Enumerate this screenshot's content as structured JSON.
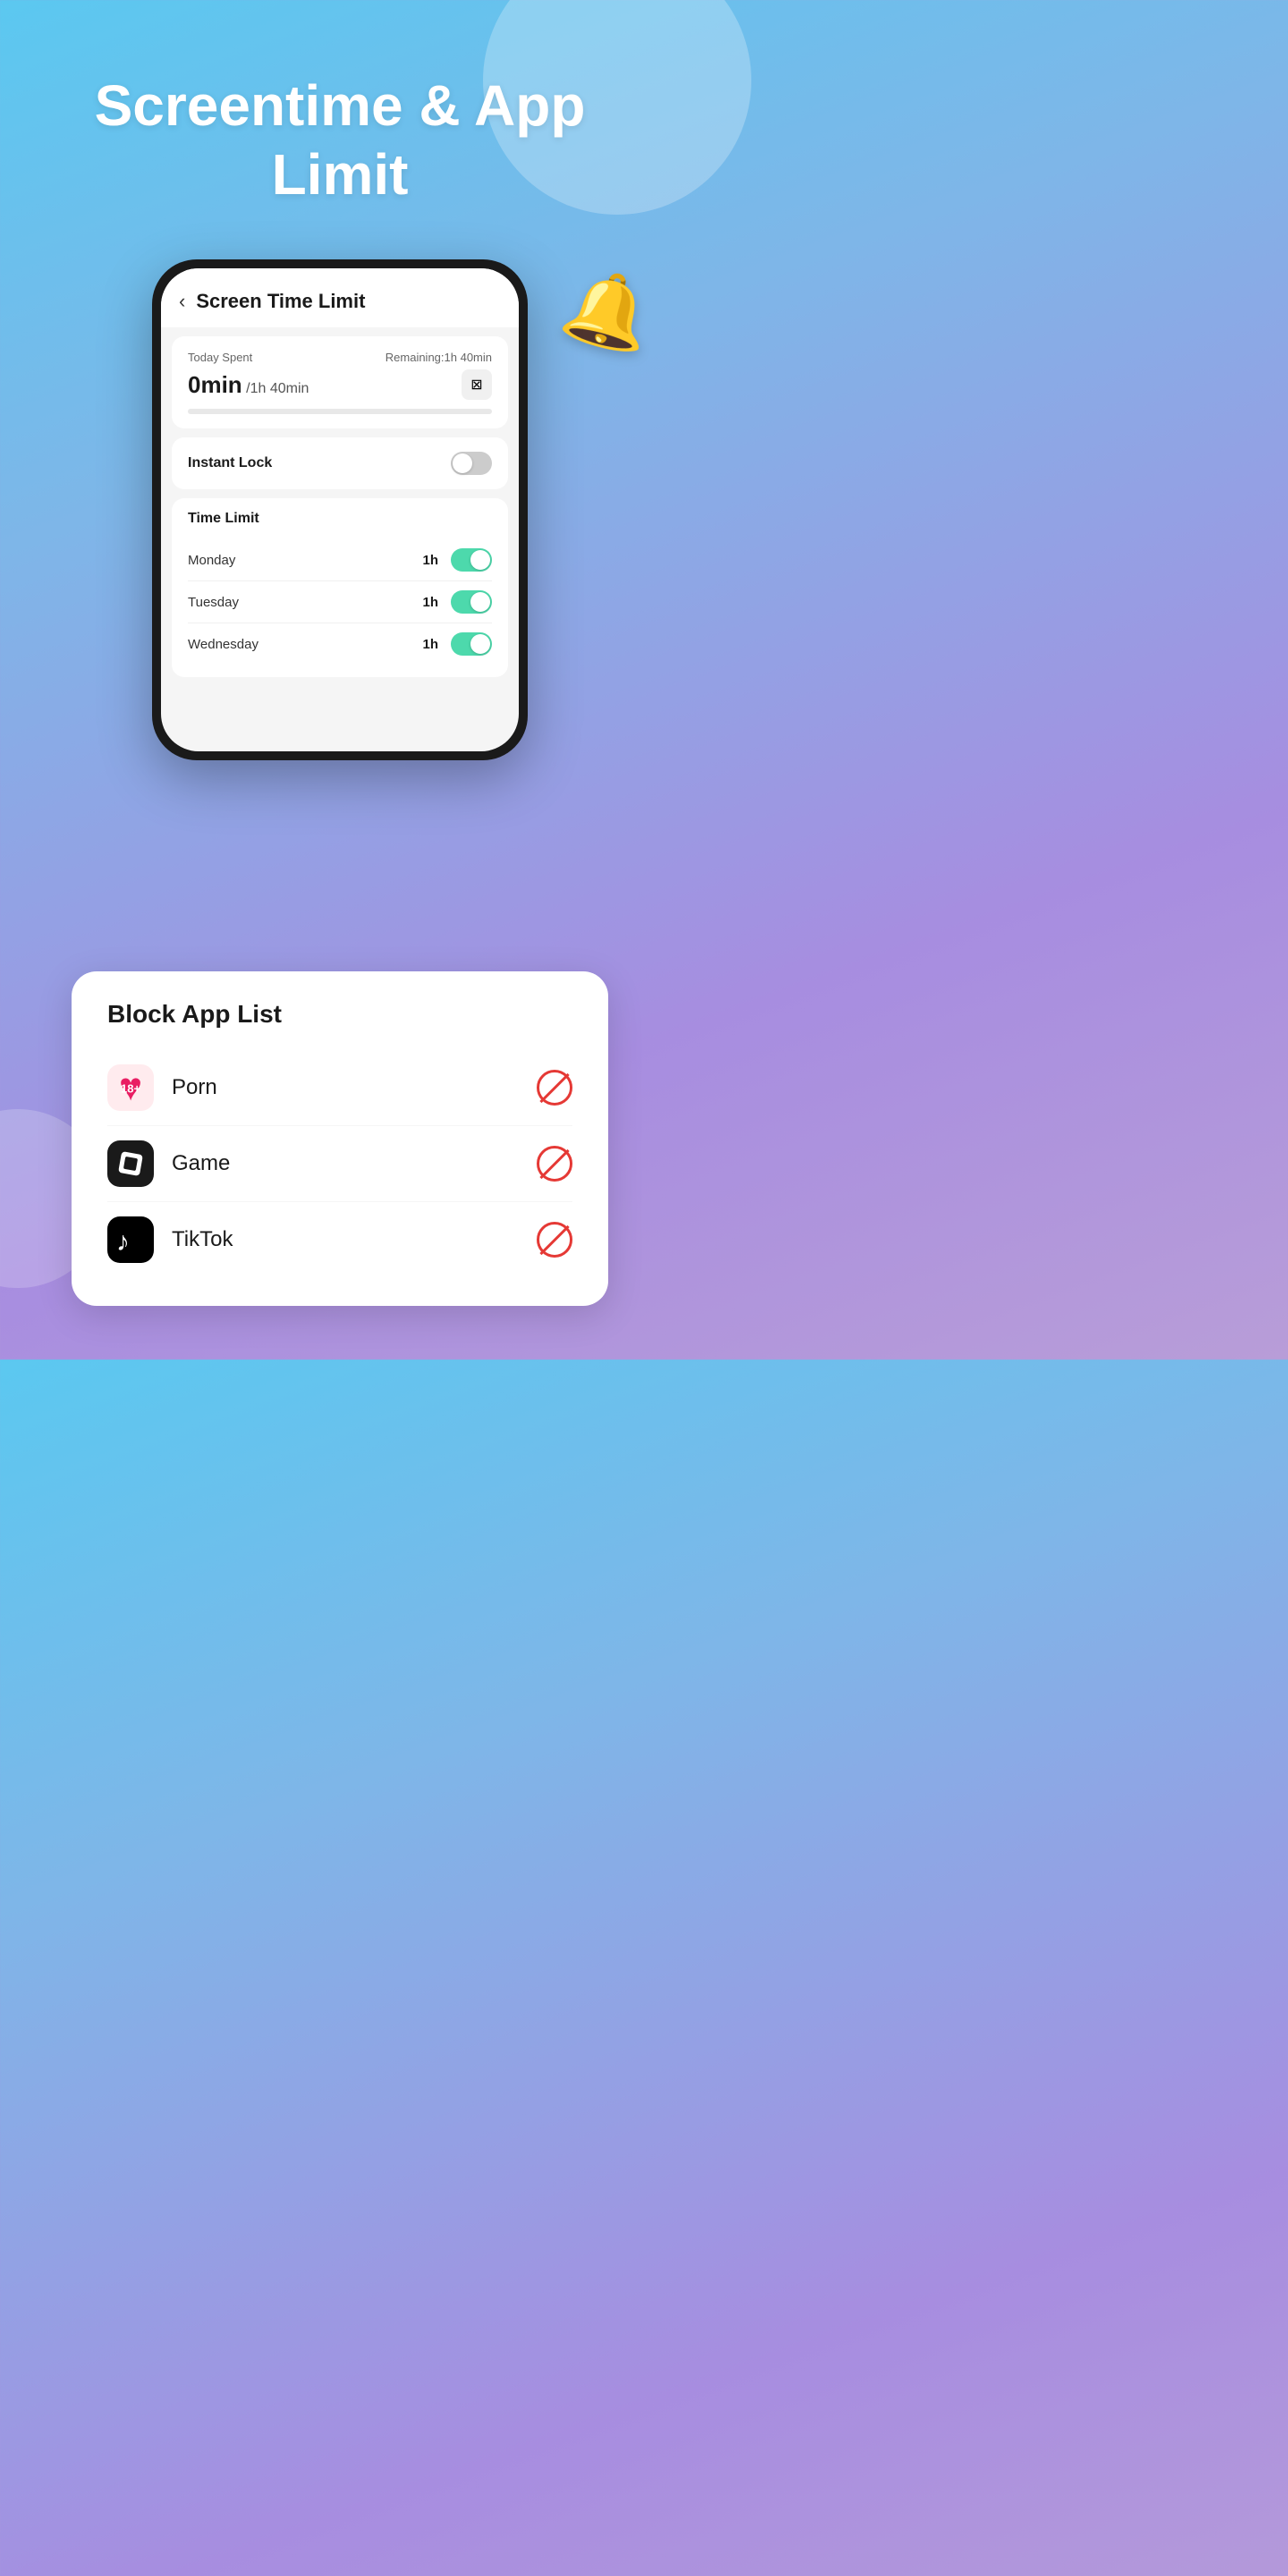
{
  "hero": {
    "title": "Screentime & App Limit"
  },
  "phone": {
    "header": {
      "back_label": "‹",
      "title": "Screen Time Limit"
    },
    "today_card": {
      "label": "Today Spent",
      "remaining_label": "Remaining:1h 40min",
      "time_spent": "0min",
      "time_limit": "/1h 40min",
      "progress_percent": 0,
      "edit_icon": "⊠"
    },
    "instant_lock": {
      "label": "Instant Lock",
      "enabled": false
    },
    "time_limit": {
      "heading": "Time Limit",
      "days": [
        {
          "name": "Monday",
          "limit": "1h",
          "enabled": true
        },
        {
          "name": "Tuesday",
          "limit": "1h",
          "enabled": true
        },
        {
          "name": "Wednesday",
          "limit": "1h",
          "enabled": true
        }
      ]
    }
  },
  "block_app_list": {
    "title": "Block App List",
    "apps": [
      {
        "name": "Porn",
        "icon_type": "porn"
      },
      {
        "name": "Game",
        "icon_type": "game"
      },
      {
        "name": "TikTok",
        "icon_type": "tiktok"
      }
    ]
  }
}
